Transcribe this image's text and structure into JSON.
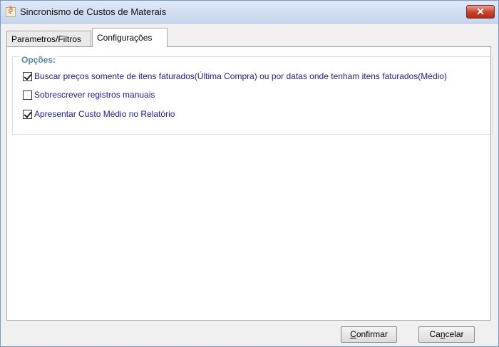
{
  "window": {
    "title": "Sincronismo de Custos de Materais",
    "close_label": "✕",
    "app_icon_glyph": "ꀅ"
  },
  "tabs": [
    {
      "label": "Parametros/Filtros",
      "active": false
    },
    {
      "label": "Configurações",
      "active": true
    }
  ],
  "group": {
    "title": "Opções:"
  },
  "options": [
    {
      "label": "Buscar preços somente de itens faturados(Última Compra) ou por datas onde tenham itens faturados(Médio)",
      "checked": true
    },
    {
      "label": "Sobrescrever registros manuais",
      "checked": false
    },
    {
      "label": "Apresentar Custo Médio no Relatório",
      "checked": true
    }
  ],
  "buttons": {
    "confirm": {
      "mnemonic": "C",
      "rest": "onfirmar"
    },
    "cancel": {
      "before": "Ca",
      "mnemonic": "n",
      "rest": "celar"
    }
  },
  "colors": {
    "option_text": "#1a1aa6",
    "group_title": "#4a8aa6"
  }
}
